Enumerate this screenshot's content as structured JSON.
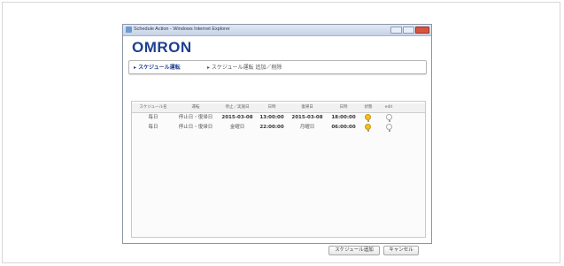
{
  "window": {
    "title": "Schedule Action - Windows Internet Explorer",
    "title_icon": "ie-page-icon"
  },
  "brand": {
    "logo": "OMRON",
    "color": "#1f3f8f"
  },
  "breadcrumb": {
    "items": [
      {
        "label": "▸ スケジュール運転",
        "active": true
      },
      {
        "label": "▸ スケジュール運転 追加／削除",
        "active": false
      }
    ]
  },
  "table": {
    "headers": [
      "スケジュール名",
      "運転",
      "停止／実施日",
      "日時",
      "復帰日",
      "日時",
      "状態",
      "edit"
    ],
    "rows": [
      {
        "name": "毎日",
        "action": "停止日・復帰日",
        "stop_date": "2015-03-08",
        "stop_time": "13:00:00",
        "resume_date": "2015-03-08",
        "resume_time": "18:00:00",
        "status": "on",
        "edit": "off"
      },
      {
        "name": "毎日",
        "action": "停止日・復帰日",
        "stop_date": "金曜日",
        "stop_time": "22:00:00",
        "resume_date": "月曜日",
        "resume_time": "06:00:00",
        "status": "on",
        "edit": "off"
      }
    ]
  },
  "buttons": {
    "apply": "スケジュール追加",
    "cancel": "キャンセル"
  },
  "colors": {
    "bulb_on": "#f3c11b",
    "bulb_off": "#ffffff",
    "close_button": "#d9543f"
  }
}
